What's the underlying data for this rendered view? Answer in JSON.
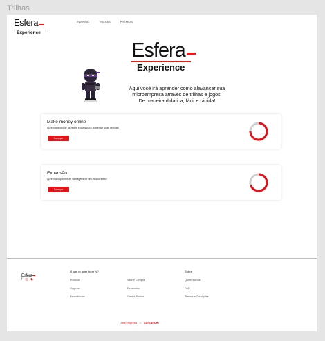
{
  "frame": {
    "label": "Trilhas"
  },
  "brand": {
    "name": "Esfera",
    "sub": "Experience"
  },
  "nav": {
    "links": [
      "RANKING",
      "TRILHAS",
      "PRÊMIOS"
    ]
  },
  "hero": {
    "lines": [
      "Aqui você irá aprender como alavancar sua",
      "microempresa através de trilhas e jogos.",
      "De maneira didática, fácil e rápida!"
    ]
  },
  "trails": [
    {
      "title": "Make money online",
      "description": "Aprenda a utilizar as redes sociais para aumentar suas vendas!",
      "button": "Começar",
      "progress": 0.75
    },
    {
      "title": "Expansão",
      "description": "Aprenda o que é e as vantagens de um microcrédito!",
      "button": "Começar",
      "progress": 0.7
    }
  ],
  "footer": {
    "logo": "Esfera",
    "question": "O que vc quer fazer hj?",
    "col1": [
      "Produtos",
      "Viagens",
      "Experiências"
    ],
    "col2": [
      "Vitrine Compra",
      "Descontos",
      "Ganhe Pontos"
    ],
    "about_title": "Sobre",
    "col3": [
      "Quem somos",
      "FAQ",
      "Termos e Condições"
    ],
    "brand_prefix": "Uma empresa",
    "brand_name": "Santander",
    "social_icons": [
      "facebook-icon",
      "instagram-icon",
      "youtube-icon"
    ]
  },
  "colors": {
    "accent": "#e0141b",
    "progress_track": "#cfcfcf"
  }
}
